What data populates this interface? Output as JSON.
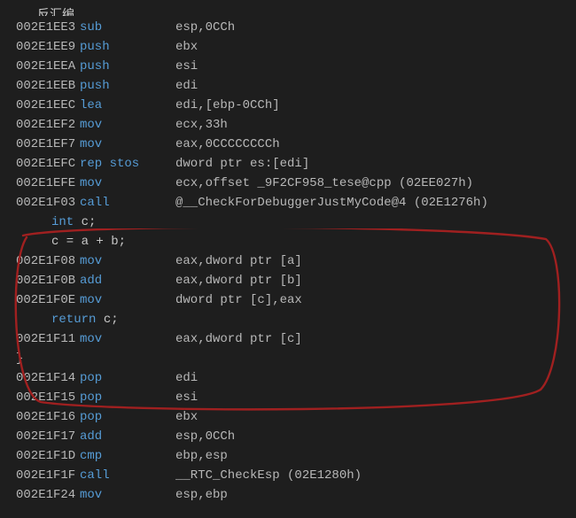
{
  "header_fragment": "反汇编",
  "lines": [
    {
      "type": "asm",
      "addr": "002E1EE3",
      "mnemonic": "sub",
      "operands": "esp,0CCh"
    },
    {
      "type": "asm",
      "addr": "002E1EE9",
      "mnemonic": "push",
      "operands": "ebx"
    },
    {
      "type": "asm",
      "addr": "002E1EEA",
      "mnemonic": "push",
      "operands": "esi"
    },
    {
      "type": "asm",
      "addr": "002E1EEB",
      "mnemonic": "push",
      "operands": "edi"
    },
    {
      "type": "asm",
      "addr": "002E1EEC",
      "mnemonic": "lea",
      "operands": "edi,[ebp-0CCh]"
    },
    {
      "type": "asm",
      "addr": "002E1EF2",
      "mnemonic": "mov",
      "operands": "ecx,33h"
    },
    {
      "type": "asm",
      "addr": "002E1EF7",
      "mnemonic": "mov",
      "operands": "eax,0CCCCCCCCh"
    },
    {
      "type": "asm",
      "addr": "002E1EFC",
      "mnemonic": "rep stos",
      "operands": "dword ptr es:[edi]"
    },
    {
      "type": "asm",
      "addr": "002E1EFE",
      "mnemonic": "mov",
      "operands": "ecx,offset _9F2CF958_tese@cpp (02EE027h)"
    },
    {
      "type": "asm",
      "addr": "002E1F03",
      "mnemonic": "call",
      "operands": "@__CheckForDebuggerJustMyCode@4 (02E1276h)"
    },
    {
      "type": "src",
      "kw": "int",
      "rest": " c;"
    },
    {
      "type": "src",
      "kw": "",
      "rest": "c = a + b;"
    },
    {
      "type": "asm",
      "addr": "002E1F08",
      "mnemonic": "mov",
      "operands": "eax,dword ptr [a]"
    },
    {
      "type": "asm",
      "addr": "002E1F0B",
      "mnemonic": "add",
      "operands": "eax,dword ptr [b]"
    },
    {
      "type": "asm",
      "addr": "002E1F0E",
      "mnemonic": "mov",
      "operands": "dword ptr [c],eax"
    },
    {
      "type": "src",
      "kw": "return",
      "rest": " c;"
    },
    {
      "type": "asm",
      "addr": "002E1F11",
      "mnemonic": "mov",
      "operands": "eax,dword ptr [c]"
    },
    {
      "type": "brace",
      "text": "}"
    },
    {
      "type": "asm",
      "addr": "002E1F14",
      "mnemonic": "pop",
      "operands": "edi"
    },
    {
      "type": "asm",
      "addr": "002E1F15",
      "mnemonic": "pop",
      "operands": "esi"
    },
    {
      "type": "asm",
      "addr": "002E1F16",
      "mnemonic": "pop",
      "operands": "ebx"
    },
    {
      "type": "asm",
      "addr": "002E1F17",
      "mnemonic": "add",
      "operands": "esp,0CCh"
    },
    {
      "type": "asm",
      "addr": "002E1F1D",
      "mnemonic": "cmp",
      "operands": "ebp,esp"
    },
    {
      "type": "asm",
      "addr": "002E1F1F",
      "mnemonic": "call",
      "operands": "__RTC_CheckEsp (02E1280h)"
    },
    {
      "type": "asm",
      "addr": "002E1F24",
      "mnemonic": "mov",
      "operands": "esp,ebp"
    }
  ],
  "colors": {
    "background": "#1e1e1e",
    "text": "#b8b8b8",
    "keyword": "#569cd6",
    "annotation": "#a02020"
  }
}
